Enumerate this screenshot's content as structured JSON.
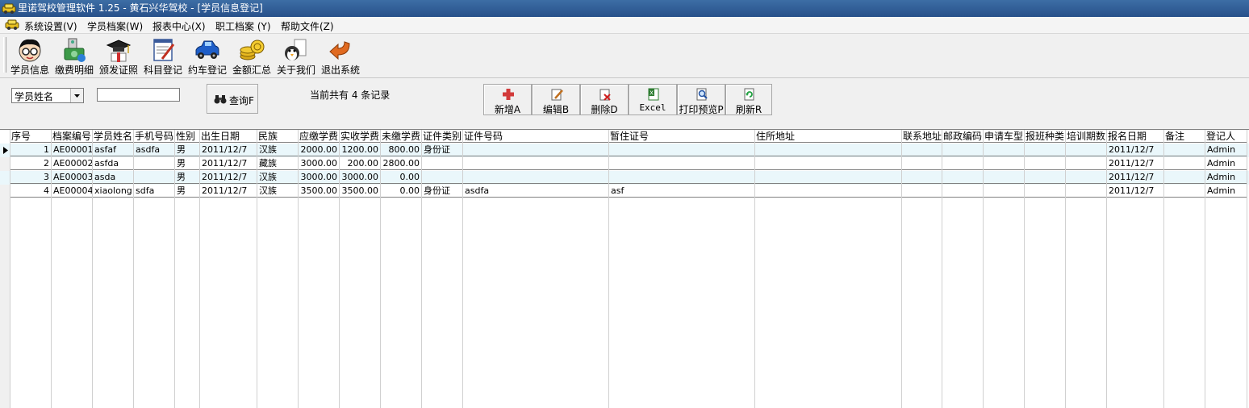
{
  "window": {
    "title": "里诺驾校管理软件 1.25 - 黄石兴华驾校 - [学员信息登记]"
  },
  "menu": [
    "系统设置(V)",
    "学员档案(W)",
    "报表中心(X)",
    "职工档案 (Y)",
    "帮助文件(Z)"
  ],
  "toolbar": [
    {
      "label": "学员信息",
      "icon": "student-face-icon"
    },
    {
      "label": "缴费明细",
      "icon": "payment-icon"
    },
    {
      "label": "颁发证照",
      "icon": "graduation-cap-icon"
    },
    {
      "label": "科目登记",
      "icon": "notepad-pen-icon"
    },
    {
      "label": "约车登记",
      "icon": "car-icon"
    },
    {
      "label": "金额汇总",
      "icon": "coins-icon"
    },
    {
      "label": "关于我们",
      "icon": "about-icon"
    },
    {
      "label": "退出系统",
      "icon": "exit-arrow-icon"
    }
  ],
  "search": {
    "field_selected": "学员姓名",
    "keyword_value": "",
    "query_label": "查询F",
    "record_text": "当前共有 4 条记录"
  },
  "actions": [
    {
      "label": "新增A",
      "icon": "add-icon"
    },
    {
      "label": "编辑B",
      "icon": "edit-icon"
    },
    {
      "label": "删除D",
      "icon": "delete-icon"
    },
    {
      "label": "Excel",
      "icon": "excel-icon"
    },
    {
      "label": "打印预览P",
      "icon": "print-preview-icon"
    },
    {
      "label": "刷新R",
      "icon": "refresh-icon"
    }
  ],
  "table": {
    "columns": [
      "序号",
      "档案编号",
      "学员姓名",
      "手机号码",
      "性别",
      "出生日期",
      "民族",
      "应缴学费",
      "实收学费",
      "未缴学费",
      "证件类别",
      "证件号码",
      "暂住证号",
      "住所地址",
      "联系地址",
      "邮政编码",
      "申请车型",
      "报班种类",
      "培训期数",
      "报名日期",
      "备注",
      "登记人"
    ],
    "rows": [
      [
        "1",
        "AE00001",
        "asfaf",
        "asdfa",
        "男",
        "2011/12/7",
        "汉族",
        "2000.00",
        "1200.00",
        "800.00",
        "身份证",
        "",
        "",
        "",
        "",
        "",
        "",
        "",
        "",
        "2011/12/7",
        "",
        "Admin"
      ],
      [
        "2",
        "AE00002",
        "asfda",
        "",
        "男",
        "2011/12/7",
        "藏族",
        "3000.00",
        "200.00",
        "2800.00",
        "",
        "",
        "",
        "",
        "",
        "",
        "",
        "",
        "",
        "2011/12/7",
        "",
        "Admin"
      ],
      [
        "3",
        "AE00003",
        "asda",
        "",
        "男",
        "2011/12/7",
        "汉族",
        "3000.00",
        "3000.00",
        "0.00",
        "",
        "",
        "",
        "",
        "",
        "",
        "",
        "",
        "",
        "2011/12/7",
        "",
        "Admin"
      ],
      [
        "4",
        "AE00004",
        "xiaolong",
        "sdfa",
        "男",
        "2011/12/7",
        "汉族",
        "3500.00",
        "3500.00",
        "0.00",
        "身份证",
        "asdfa",
        "asf",
        "",
        "",
        "",
        "",
        "",
        "",
        "2011/12/7",
        "",
        "Admin"
      ]
    ]
  },
  "colors": {
    "titlebar": "#27508a",
    "row_alt": "#eaf7fb",
    "add_icon": "#d23a3a",
    "exit_icon": "#e06a20"
  }
}
